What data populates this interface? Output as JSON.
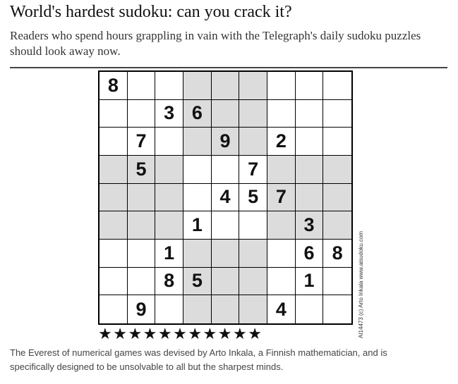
{
  "article": {
    "headline": "World's hardest sudoku: can you crack it?",
    "standfirst": "Readers who spend hours grappling in vain with the Telegraph's daily sudoku puzzles should look away now.",
    "caption": "The Everest of numerical games was devised by Arto Inkala, a Finnish mathematician, and is specifically designed to be unsolvable to all but the sharpest minds."
  },
  "sudoku": {
    "credit": "AI14473 (c) Arto Inkala www.aisudoku.com",
    "stars": "★★★★★★★★★★★",
    "shaded_box_color": "#dcdcdc",
    "shaded_boxes": [
      [
        0,
        1
      ],
      [
        1,
        0
      ],
      [
        1,
        2
      ],
      [
        2,
        1
      ]
    ],
    "grid": [
      [
        "8",
        "",
        "",
        "",
        "",
        "",
        "",
        "",
        ""
      ],
      [
        "",
        "",
        "3",
        "6",
        "",
        "",
        "",
        "",
        ""
      ],
      [
        "",
        "7",
        "",
        "",
        "9",
        "",
        "2",
        "",
        ""
      ],
      [
        "",
        "5",
        "",
        "",
        "",
        "7",
        "",
        "",
        ""
      ],
      [
        "",
        "",
        "",
        "",
        "4",
        "5",
        "7",
        "",
        ""
      ],
      [
        "",
        "",
        "",
        "1",
        "",
        "",
        "",
        "3",
        ""
      ],
      [
        "",
        "",
        "1",
        "",
        "",
        "",
        "",
        "6",
        "8"
      ],
      [
        "",
        "",
        "8",
        "5",
        "",
        "",
        "",
        "1",
        ""
      ],
      [
        "",
        "9",
        "",
        "",
        "",
        "",
        "4",
        "",
        ""
      ]
    ]
  }
}
